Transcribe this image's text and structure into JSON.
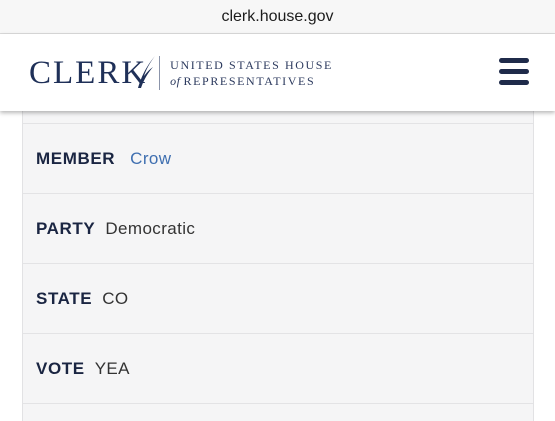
{
  "browser": {
    "url": "clerk.house.gov"
  },
  "header": {
    "logo_text": "CLERK",
    "subtitle_line1": "UNITED STATES HOUSE",
    "subtitle_of": "of",
    "subtitle_line2": "REPRESENTATIVES",
    "menu_icon": "hamburger-menu-icon"
  },
  "record": {
    "member": {
      "label": "MEMBER",
      "value": "Crow"
    },
    "party": {
      "label": "PARTY",
      "value": "Democratic"
    },
    "state": {
      "label": "STATE",
      "value": "CO"
    },
    "vote": {
      "label": "VOTE",
      "value": "YEA"
    }
  },
  "colors": {
    "brand_navy": "#1f3058",
    "link_blue": "#3f6fb0",
    "panel_bg": "#f5f5f6"
  }
}
